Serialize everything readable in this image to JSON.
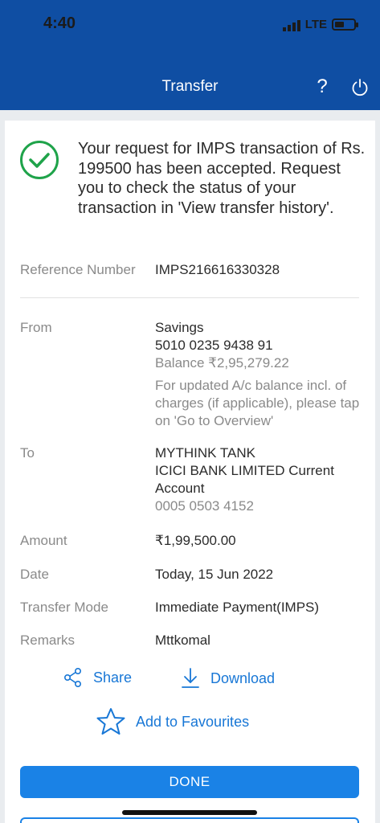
{
  "status_bar": {
    "time": "4:40",
    "network": "LTE"
  },
  "header": {
    "title": "Transfer",
    "help_label": "?"
  },
  "message": {
    "text": "Your request for IMPS transaction of Rs. 199500 has been accepted. Request you to check the status of your transaction in 'View transfer history'."
  },
  "details": {
    "reference": {
      "label": "Reference Number",
      "value": "IMPS216616330328"
    },
    "from": {
      "label": "From",
      "account_type": "Savings",
      "account_number": "5010 0235 9438 91",
      "balance": "Balance ₹2,95,279.22",
      "note": "For updated A/c balance incl. of charges (if applicable), please tap on 'Go to Overview'"
    },
    "to": {
      "label": "To",
      "name": "MYTHINK TANK",
      "bank": "ICICI BANK LIMITED Current Account",
      "account_number": "0005 0503 4152"
    },
    "amount": {
      "label": "Amount",
      "value": "₹1,99,500.00"
    },
    "date": {
      "label": "Date",
      "value": "Today, 15 Jun 2022"
    },
    "mode": {
      "label": "Transfer Mode",
      "value": "Immediate Payment(IMPS)"
    },
    "remarks": {
      "label": "Remarks",
      "value": "Mttkomal"
    }
  },
  "actions": {
    "share": "Share",
    "download": "Download",
    "favourites": "Add to Favourites",
    "done": "DONE"
  },
  "colors": {
    "header_bg": "#0f4ea3",
    "accent": "#1a82e6",
    "success": "#1fa34a"
  }
}
